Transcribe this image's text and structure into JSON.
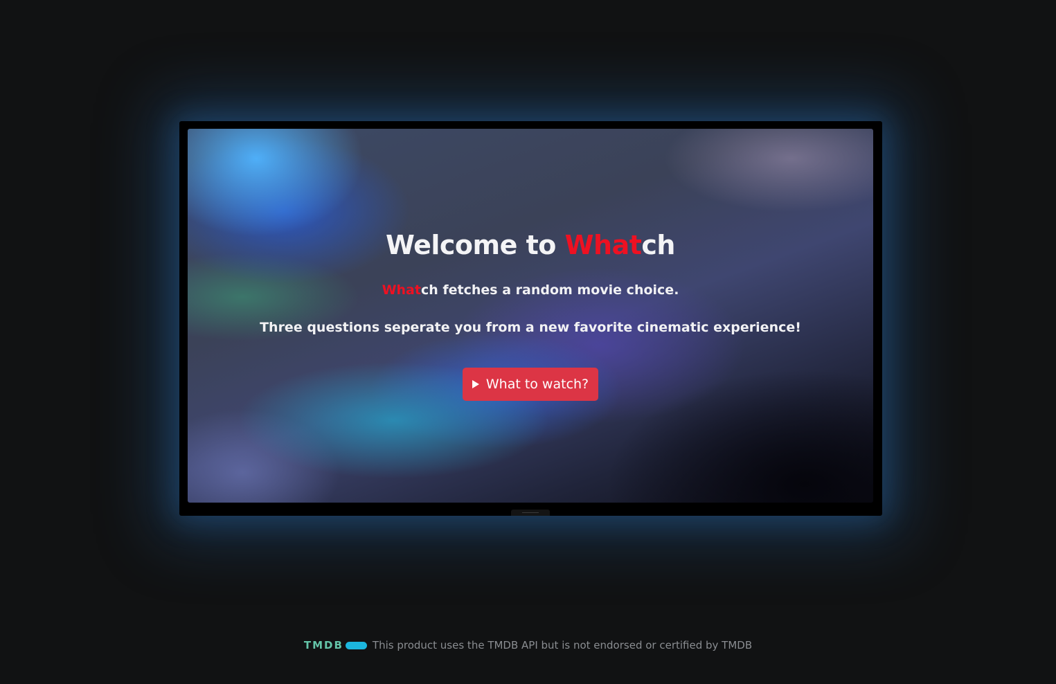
{
  "hero": {
    "title_prefix": "Welcome to ",
    "title_brand_accent": "What",
    "title_brand_rest": "ch",
    "intro_brand_accent": "What",
    "intro_brand_rest": "ch",
    "intro_text": " fetches a random movie choice.",
    "tagline": "Three questions seperate you from a new favorite cinematic experience!",
    "cta_label": "What to watch?",
    "cta_icon": "play-icon"
  },
  "footer": {
    "logo_text": "TMDB",
    "disclaimer": "This product uses the TMDB API but is not endorsed or certified by TMDB"
  },
  "colors": {
    "background": "#111213",
    "brand_accent": "#ee1122",
    "cta_button": "#dc3545",
    "tmdb_green": "#64c4a8",
    "tmdb_blue": "#1cb6de"
  }
}
